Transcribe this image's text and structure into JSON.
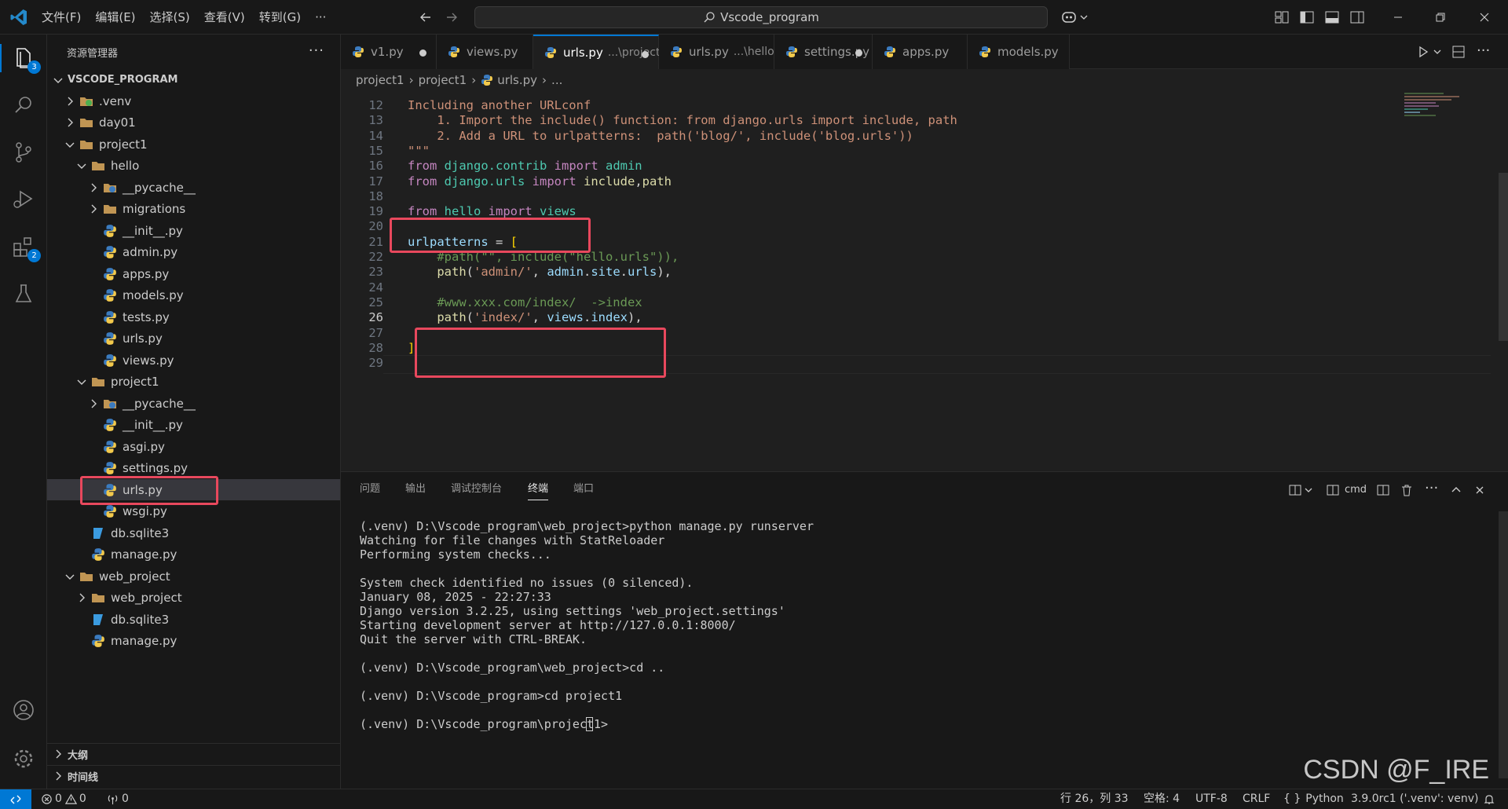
{
  "menu": [
    "文件(F)",
    "编辑(E)",
    "选择(S)",
    "查看(V)",
    "转到(G)",
    "···"
  ],
  "search_box": "Vscode_program",
  "activity_badges": {
    "explorer": "3",
    "extensions": "2"
  },
  "sidebar": {
    "title": "资源管理器",
    "root": "VSCODE_PROGRAM",
    "tree": [
      {
        "label": ".venv",
        "kind": "venv",
        "depth": 1,
        "chevron": "right"
      },
      {
        "label": "day01",
        "kind": "folder",
        "depth": 1,
        "chevron": "right"
      },
      {
        "label": "project1",
        "kind": "folder",
        "depth": 1,
        "chevron": "down"
      },
      {
        "label": "hello",
        "kind": "folder",
        "depth": 2,
        "chevron": "down"
      },
      {
        "label": "__pycache__",
        "kind": "pycache",
        "depth": 3,
        "chevron": "right"
      },
      {
        "label": "migrations",
        "kind": "folder",
        "depth": 3,
        "chevron": "right"
      },
      {
        "label": "__init__.py",
        "kind": "py",
        "depth": 3
      },
      {
        "label": "admin.py",
        "kind": "py",
        "depth": 3
      },
      {
        "label": "apps.py",
        "kind": "py",
        "depth": 3
      },
      {
        "label": "models.py",
        "kind": "py",
        "depth": 3
      },
      {
        "label": "tests.py",
        "kind": "py",
        "depth": 3
      },
      {
        "label": "urls.py",
        "kind": "py",
        "depth": 3
      },
      {
        "label": "views.py",
        "kind": "py",
        "depth": 3
      },
      {
        "label": "project1",
        "kind": "folder",
        "depth": 2,
        "chevron": "down"
      },
      {
        "label": "__pycache__",
        "kind": "pycache",
        "depth": 3,
        "chevron": "right"
      },
      {
        "label": "__init__.py",
        "kind": "py",
        "depth": 3
      },
      {
        "label": "asgi.py",
        "kind": "py",
        "depth": 3
      },
      {
        "label": "settings.py",
        "kind": "py",
        "depth": 3
      },
      {
        "label": "urls.py",
        "kind": "py",
        "depth": 3,
        "selected": true
      },
      {
        "label": "wsgi.py",
        "kind": "py",
        "depth": 3
      },
      {
        "label": "db.sqlite3",
        "kind": "db",
        "depth": 2
      },
      {
        "label": "manage.py",
        "kind": "py",
        "depth": 2
      },
      {
        "label": "web_project",
        "kind": "folder",
        "depth": 1,
        "chevron": "down"
      },
      {
        "label": "web_project",
        "kind": "folder",
        "depth": 2,
        "chevron": "right"
      },
      {
        "label": "db.sqlite3",
        "kind": "db",
        "depth": 2
      },
      {
        "label": "manage.py",
        "kind": "py",
        "depth": 2
      }
    ],
    "outline": "大纲",
    "timeline": "时间线"
  },
  "tabs": [
    {
      "label": "v1.py",
      "desc": "",
      "dirty": true,
      "active": false
    },
    {
      "label": "views.py",
      "desc": "",
      "dirty": false,
      "active": false
    },
    {
      "label": "urls.py",
      "desc": "...\\project1",
      "dirty": true,
      "active": true
    },
    {
      "label": "urls.py",
      "desc": "...\\hello",
      "dirty": false,
      "active": false
    },
    {
      "label": "settings.py",
      "desc": "",
      "dirty": true,
      "active": false
    },
    {
      "label": "apps.py",
      "desc": "",
      "dirty": false,
      "active": false
    },
    {
      "label": "models.py",
      "desc": "",
      "dirty": false,
      "active": false
    }
  ],
  "breadcrumb": [
    "project1",
    "project1",
    "urls.py",
    "..."
  ],
  "editor": {
    "lines": [
      {
        "n": "12",
        "tokens": [
          [
            "c-str",
            "Including another URLconf"
          ]
        ]
      },
      {
        "n": "13",
        "tokens": [
          [
            "c-str",
            "    1. Import the include() function: from django.urls import include, path"
          ]
        ]
      },
      {
        "n": "14",
        "tokens": [
          [
            "c-str",
            "    2. Add a URL to urlpatterns:  path('blog/', include('blog.urls'))"
          ]
        ]
      },
      {
        "n": "15",
        "tokens": [
          [
            "c-str",
            "\"\"\""
          ]
        ]
      },
      {
        "n": "16",
        "tokens": [
          [
            "c-kw",
            "from "
          ],
          [
            "c-mod",
            "django.contrib"
          ],
          [
            "c-kw",
            " import "
          ],
          [
            "c-mod",
            "admin"
          ]
        ]
      },
      {
        "n": "17",
        "tokens": [
          [
            "c-kw",
            "from "
          ],
          [
            "c-mod",
            "django.urls"
          ],
          [
            "c-kw",
            " import "
          ],
          [
            "c-fn",
            "include"
          ],
          [
            "c-pl",
            ","
          ],
          [
            "c-fn",
            "path"
          ]
        ]
      },
      {
        "n": "18",
        "tokens": []
      },
      {
        "n": "19",
        "tokens": [
          [
            "c-kw",
            "from "
          ],
          [
            "c-mod",
            "hello"
          ],
          [
            "c-kw",
            " import "
          ],
          [
            "c-mod",
            "views"
          ]
        ]
      },
      {
        "n": "20",
        "tokens": []
      },
      {
        "n": "21",
        "tokens": [
          [
            "c-var",
            "urlpatterns"
          ],
          [
            "c-pl",
            " = "
          ],
          [
            "c-br",
            "["
          ]
        ]
      },
      {
        "n": "22",
        "tokens": [
          [
            "c-com",
            "    #path(\"\", include(\"hello.urls\")),"
          ]
        ]
      },
      {
        "n": "23",
        "tokens": [
          [
            "c-fn",
            "    path"
          ],
          [
            "c-pl",
            "("
          ],
          [
            "c-str",
            "'admin/'"
          ],
          [
            "c-pl",
            ", "
          ],
          [
            "c-var",
            "admin"
          ],
          [
            "c-pl",
            "."
          ],
          [
            "c-var",
            "site"
          ],
          [
            "c-pl",
            "."
          ],
          [
            "c-var",
            "urls"
          ],
          [
            "c-pl",
            "),"
          ]
        ]
      },
      {
        "n": "24",
        "tokens": []
      },
      {
        "n": "25",
        "tokens": [
          [
            "c-com",
            "    #www.xxx.com/index/  ->index"
          ]
        ]
      },
      {
        "n": "26",
        "tokens": [
          [
            "c-fn",
            "    path"
          ],
          [
            "c-pl",
            "("
          ],
          [
            "c-str",
            "'index/'"
          ],
          [
            "c-pl",
            ", "
          ],
          [
            "c-var",
            "views"
          ],
          [
            "c-pl",
            "."
          ],
          [
            "c-var",
            "index"
          ],
          [
            "c-pl",
            "),"
          ]
        ],
        "current": true
      },
      {
        "n": "27",
        "tokens": []
      },
      {
        "n": "28",
        "tokens": [
          [
            "c-br",
            "]"
          ]
        ]
      },
      {
        "n": "29",
        "tokens": []
      }
    ]
  },
  "panel": {
    "tabs": [
      "问题",
      "输出",
      "调试控制台",
      "终端",
      "端口"
    ],
    "active_tab": "终端",
    "shell": "cmd",
    "terminal": [
      "(.venv) D:\\Vscode_program\\web_project>python manage.py runserver",
      "Watching for file changes with StatReloader",
      "Performing system checks...",
      "",
      "System check identified no issues (0 silenced).",
      "January 08, 2025 - 22:27:33",
      "Django version 3.2.25, using settings 'web_project.settings'",
      "Starting development server at http://127.0.0.1:8000/",
      "Quit the server with CTRL-BREAK.",
      "",
      "(.venv) D:\\Vscode_program\\web_project>cd ..",
      "",
      "(.venv) D:\\Vscode_program>cd project1",
      "",
      "(.venv) D:\\Vscode_program\\project1>"
    ],
    "watermark": "CSDN @F_IRE"
  },
  "statusbar": {
    "errors": "0",
    "warnings": "0",
    "ports": "0",
    "position": "行 26，列 33",
    "spaces": "空格: 4",
    "encoding": "UTF-8",
    "eol": "CRLF",
    "language": "Python",
    "interpreter": "3.9.0rc1 ('.venv': venv)"
  }
}
